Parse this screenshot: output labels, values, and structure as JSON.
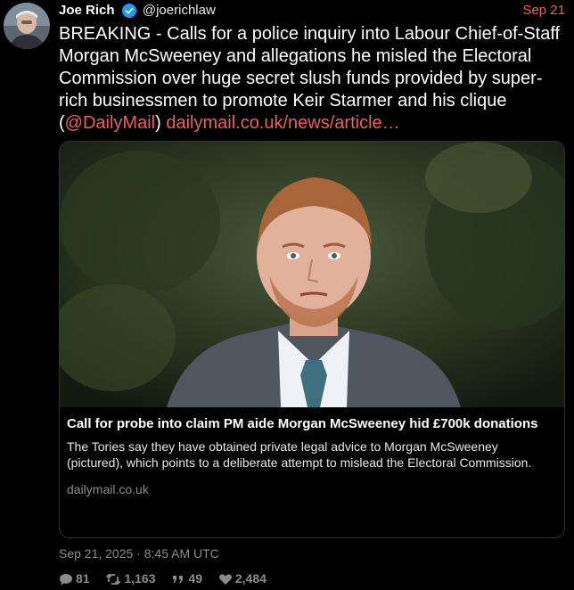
{
  "author": {
    "name": "Joe Rich",
    "handle": "@joerichlaw",
    "verified": true,
    "avatar_icon": "profile-photo"
  },
  "date_short": "Sep 21",
  "tweet": {
    "text": "BREAKING - Calls for a police inquiry into Labour Chief-of-Staff Morgan McSweeney and allegations he misled the Electoral Commission over huge secret slush funds provided by super-rich businessmen to promote Keir Starmer and his clique (",
    "mention": "@DailyMail",
    "after_mention": ") ",
    "link": "dailymail.co.uk/news/article…"
  },
  "card": {
    "title": "Call for probe into claim PM aide Morgan McSweeney hid £700k donations",
    "description": "The Tories say they have obtained private legal advice to Morgan McSweeney (pictured), which points to a deliberate attempt to mislead the Electoral Commission.",
    "domain": "dailymail.co.uk",
    "image_icon": "news-photo"
  },
  "timestamp": "Sep 21, 2025 · 8:45 AM UTC",
  "stats": {
    "replies": "81",
    "retweets": "1,163",
    "quotes": "49",
    "likes": "2,484"
  },
  "colors": {
    "background": "#000000",
    "accent_link": "#f25c5c",
    "muted": "#8b8b8b",
    "verified": "#1d9bf0"
  }
}
